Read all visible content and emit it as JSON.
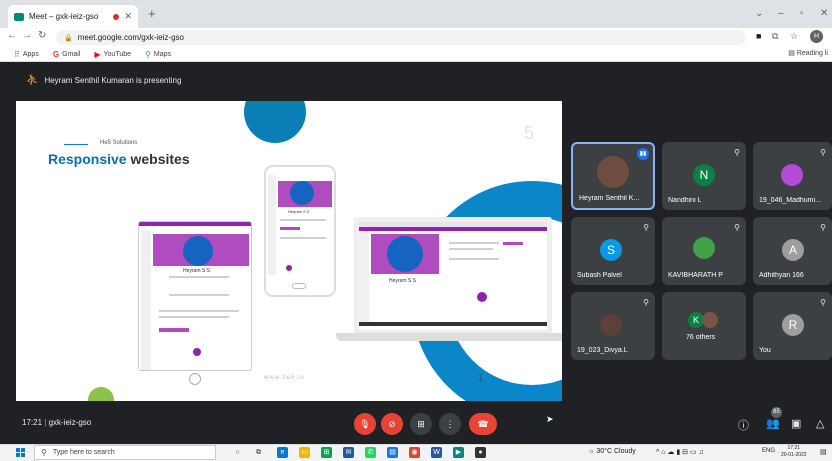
{
  "browser": {
    "tab_title": "Meet – gxk-ieiz-gso",
    "url": "meet.google.com/gxk-ieiz-gso",
    "bookmarks": [
      "Apps",
      "Gmail",
      "YouTube",
      "Maps"
    ],
    "reading_list": "Reading li",
    "profile_initial": "H"
  },
  "meet": {
    "presenting_text": "Heyram Senthil Kumaran is presenting",
    "time": "17:21",
    "meeting_code": "gxk-ieiz-gso",
    "people_count": "85"
  },
  "slide": {
    "subtitle": "He5 Solutions",
    "headline_accent": "Responsive",
    "headline_rest": " websites",
    "number": "5",
    "watermark": "www.he5.in",
    "device_name": "Heyram S S"
  },
  "participants": [
    {
      "name": "Heyram Senthil K...",
      "initial": "",
      "color": "#6d4c41",
      "active": true
    },
    {
      "name": "Nandhini L",
      "initial": "N",
      "color": "#0b8043",
      "active": false
    },
    {
      "name": "19_046_Madhumi...",
      "initial": "",
      "color": "#b24bd8",
      "active": false
    },
    {
      "name": "Subash Palvel",
      "initial": "S",
      "color": "#039be5",
      "active": false
    },
    {
      "name": "KAVIBHARATH P",
      "initial": "",
      "color": "#43a047",
      "active": false
    },
    {
      "name": "Adhithyan 166",
      "initial": "A",
      "color": "#9e9e9e",
      "active": false
    },
    {
      "name": "19_023_Divya.L",
      "initial": "",
      "color": "#5d4037",
      "active": false
    },
    {
      "name": "76 others",
      "initial": "K",
      "color": "#0b8043",
      "active": false
    },
    {
      "name": "You",
      "initial": "R",
      "color": "#9e9e9e",
      "active": false
    }
  ],
  "taskbar": {
    "search_placeholder": "Type here to search",
    "weather": "30°C  Cloudy",
    "lang": "ENG",
    "clock": "17:21",
    "date": "20-01-2022"
  },
  "colors": {
    "accent": "#8ab4f8",
    "danger": "#ea4335",
    "slide_blue": "#0b86c8",
    "purple": "#8e24aa"
  }
}
